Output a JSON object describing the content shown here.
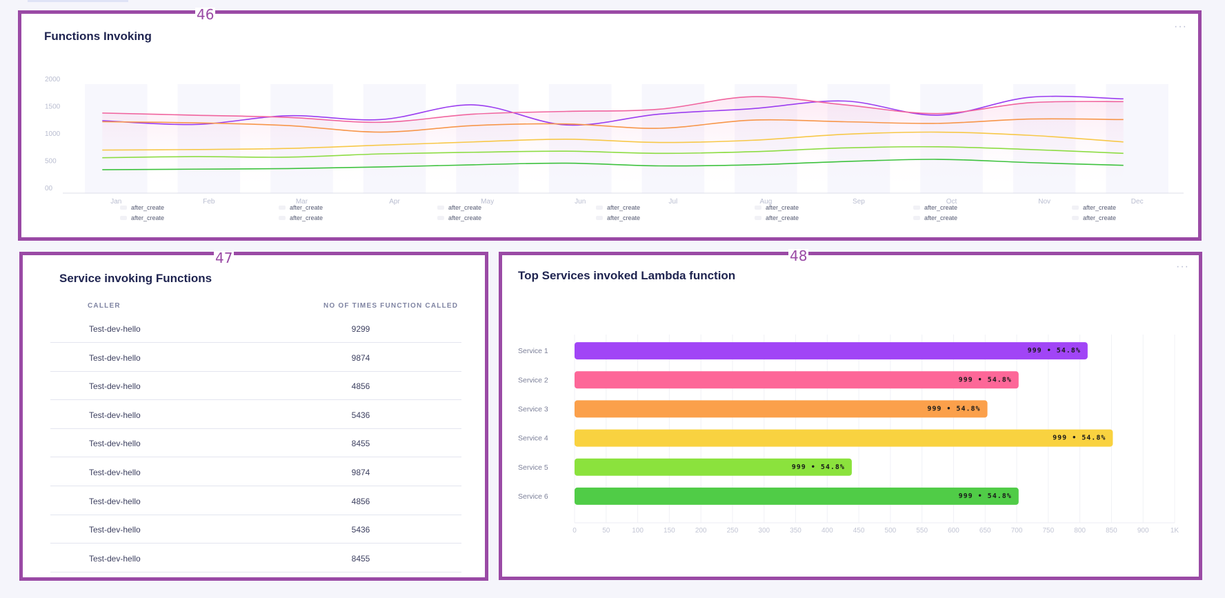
{
  "regions": {
    "n46": "46",
    "n47": "47",
    "n48": "48"
  },
  "functions_invoking": {
    "title": "Functions Invoking",
    "menu": "···",
    "legend": [
      "after_create",
      "after_create",
      "after_create",
      "after_create",
      "after_create",
      "after_create",
      "after_create",
      "after_create",
      "after_create",
      "after_create",
      "after_create",
      "after_create",
      "after_create",
      "after_create"
    ]
  },
  "service_invoking": {
    "title": "Service invoking Functions",
    "col_caller": "CALLER",
    "col_count": "NO OF TIMES FUNCTION CALLED",
    "rows": [
      {
        "caller": "Test-dev-hello",
        "count": "9299"
      },
      {
        "caller": "Test-dev-hello",
        "count": "9874"
      },
      {
        "caller": "Test-dev-hello",
        "count": "4856"
      },
      {
        "caller": "Test-dev-hello",
        "count": "5436"
      },
      {
        "caller": "Test-dev-hello",
        "count": "8455"
      },
      {
        "caller": "Test-dev-hello",
        "count": "9874"
      },
      {
        "caller": "Test-dev-hello",
        "count": "4856"
      },
      {
        "caller": "Test-dev-hello",
        "count": "5436"
      },
      {
        "caller": "Test-dev-hello",
        "count": "8455"
      }
    ]
  },
  "top_services": {
    "title": "Top Services invoked Lambda function",
    "menu": "···"
  },
  "chart_data": [
    {
      "type": "line",
      "categories": [
        "Jan",
        "Feb",
        "Mar",
        "Apr",
        "May",
        "Jun",
        "Jul",
        "Aug",
        "Sep",
        "Oct",
        "Nov",
        "Dec"
      ],
      "y_ticks": [
        "00",
        "500",
        "1000",
        "1500",
        "2000"
      ],
      "ylim": [
        0,
        2000
      ],
      "grid": false,
      "series": [
        {
          "color": "#9b3df0",
          "values": [
            1330,
            1260,
            1420,
            1350,
            1620,
            1250,
            1450,
            1550,
            1690,
            1430,
            1760,
            1730
          ]
        },
        {
          "color": "#f0649e",
          "values": [
            1470,
            1430,
            1390,
            1300,
            1450,
            1500,
            1540,
            1770,
            1620,
            1460,
            1660,
            1680
          ]
        },
        {
          "color": "#f7964a",
          "values": [
            1310,
            1290,
            1240,
            1120,
            1240,
            1270,
            1190,
            1340,
            1310,
            1280,
            1360,
            1350
          ]
        },
        {
          "color": "#f7c848",
          "values": [
            790,
            800,
            820,
            880,
            940,
            990,
            930,
            970,
            1080,
            1120,
            1060,
            940
          ]
        },
        {
          "color": "#8ddc43",
          "values": [
            650,
            670,
            660,
            720,
            750,
            770,
            730,
            760,
            830,
            850,
            800,
            730
          ]
        },
        {
          "color": "#3ec23e",
          "values": [
            430,
            440,
            450,
            480,
            520,
            550,
            500,
            520,
            580,
            620,
            560,
            510
          ]
        }
      ]
    },
    {
      "type": "bar",
      "orientation": "horizontal",
      "categories": [
        "Service 1",
        "Service 2",
        "Service 3",
        "Service 4",
        "Service 5",
        "Service 6"
      ],
      "values": [
        855,
        740,
        688,
        897,
        462,
        740
      ],
      "labels": [
        "999 • 54.8%",
        "999 • 54.8%",
        "999 • 54.8%",
        "999 • 54.8%",
        "999 • 54.8%",
        "999 • 54.8%"
      ],
      "colors": [
        "#a145f6",
        "#fd6798",
        "#fba04b",
        "#f9d240",
        "#8be23d",
        "#50cc47"
      ],
      "x_ticks": [
        "0",
        "50",
        "100",
        "150",
        "200",
        "250",
        "300",
        "350",
        "400",
        "450",
        "500",
        "550",
        "600",
        "650",
        "700",
        "750",
        "800",
        "850",
        "900",
        "1K"
      ],
      "xlim": [
        0,
        1000
      ],
      "grid": true
    }
  ]
}
